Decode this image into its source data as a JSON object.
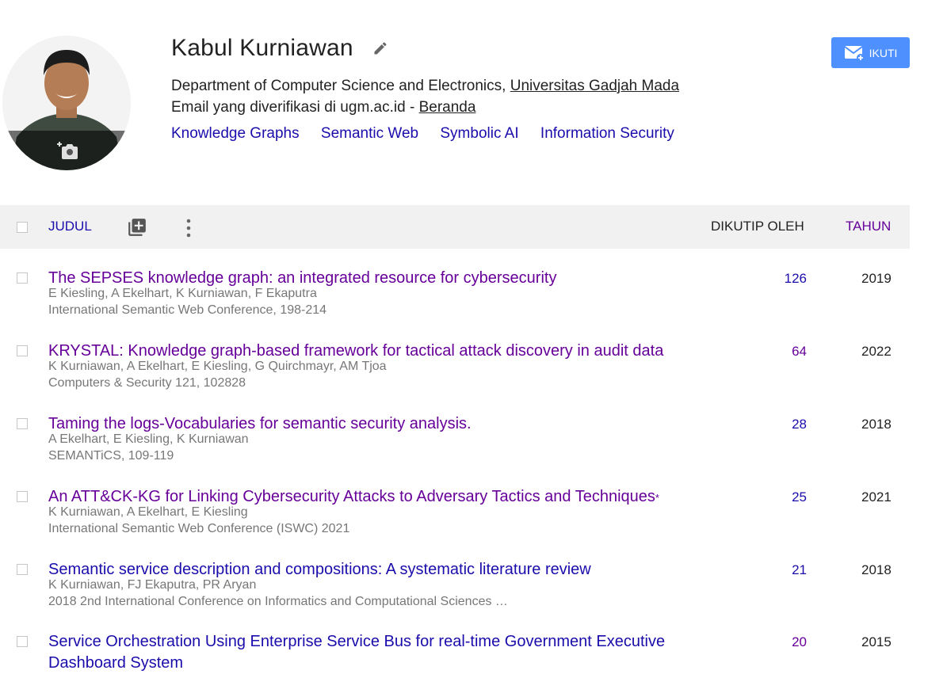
{
  "profile": {
    "name": "Kabul Kurniawan",
    "affiliation_prefix": "Department of Computer Science and Electronics, ",
    "affiliation_link": "Universitas Gadjah Mada",
    "email_text": "Email yang diverifikasi di ugm.ac.id - ",
    "homepage_link": "Beranda",
    "interests": [
      "Knowledge Graphs",
      "Semantic Web",
      "Symbolic AI",
      "Information Security"
    ],
    "follow_label": "IKUTI"
  },
  "table": {
    "col_title": "JUDUL",
    "col_cited": "DIKUTIP OLEH",
    "col_year": "TAHUN",
    "rows": [
      {
        "title": "The SEPSES knowledge graph: an integrated resource for cybersecurity",
        "authors": "E Kiesling, A Ekelhart, K Kurniawan, F Ekaputra",
        "venue": "International Semantic Web Conference, 198-214",
        "cited": "126",
        "year": "2019"
      },
      {
        "title": "KRYSTAL: Knowledge graph-based framework for tactical attack discovery in audit data",
        "authors": "K Kurniawan, A Ekelhart, E Kiesling, G Quirchmayr, AM Tjoa",
        "venue": "Computers & Security 121, 102828",
        "cited": "64",
        "year": "2022"
      },
      {
        "title": "Taming the logs-Vocabularies for semantic security analysis.",
        "authors": "A Ekelhart, E Kiesling, K Kurniawan",
        "venue": "SEMANTiCS, 109-119",
        "cited": "28",
        "year": "2018"
      },
      {
        "title": "An ATT&CK-KG for Linking Cybersecurity Attacks to Adversary Tactics and Techniques",
        "title_mark": "*",
        "authors": "K Kurniawan, A Ekelhart, E Kiesling",
        "venue": "International Semantic Web Conference (ISWC) 2021",
        "cited": "25",
        "year": "2021"
      },
      {
        "title": "Semantic service description and compositions: A systematic literature review",
        "authors": "K Kurniawan, FJ Ekaputra, PR Aryan",
        "venue": "2018 2nd International Conference on Informatics and Computational Sciences …",
        "cited": "21",
        "year": "2018"
      },
      {
        "title": "Service Orchestration Using Enterprise Service Bus for real-time Government Executive Dashboard System",
        "authors": "",
        "venue": "",
        "cited": "20",
        "year": "2015"
      }
    ]
  },
  "icons": {
    "avatar_overlay": "add-photo-icon",
    "edit": "pencil-icon",
    "follow": "email-plus-icon",
    "add": "library-add-icon",
    "more": "more-vert-icon"
  },
  "colors": {
    "link": "#1a0dab",
    "visited": "#660099",
    "follow_bg": "#4d90fe",
    "header_bg": "#f1f1f1",
    "meta_text": "#777777"
  }
}
